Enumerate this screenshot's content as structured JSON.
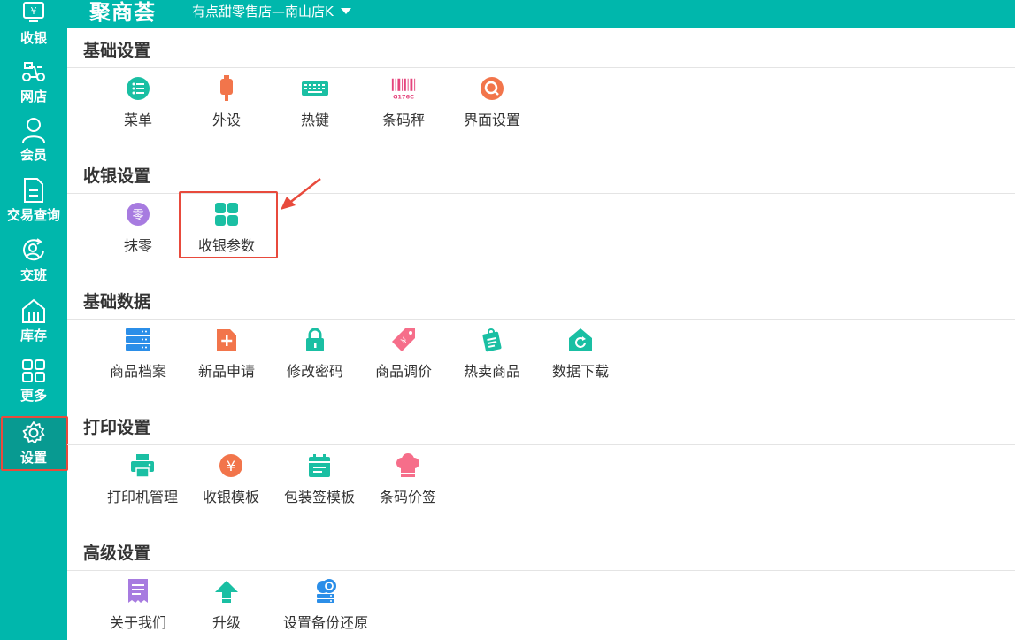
{
  "app": {
    "logo_text": "聚商荟",
    "store_name": "有点甜零售店—南山店K"
  },
  "sidebar": {
    "items": [
      {
        "label": "收银",
        "icon": "cash-register-icon"
      },
      {
        "label": "网店",
        "icon": "delivery-scooter-icon"
      },
      {
        "label": "会员",
        "icon": "member-user-icon"
      },
      {
        "label": "交易查询",
        "icon": "document-icon"
      },
      {
        "label": "交班",
        "icon": "shift-handover-icon"
      },
      {
        "label": "库存",
        "icon": "warehouse-icon"
      },
      {
        "label": "更多",
        "icon": "grid-more-icon"
      },
      {
        "label": "设置",
        "icon": "gear-icon",
        "active": true
      }
    ]
  },
  "sections": [
    {
      "title": "基础设置",
      "items": [
        {
          "label": "菜单",
          "icon": "menu-list-icon",
          "color": "#1abfa3"
        },
        {
          "label": "外设",
          "icon": "peripheral-device-icon",
          "color": "#f2754b"
        },
        {
          "label": "热键",
          "icon": "keyboard-icon",
          "color": "#1abfa3"
        },
        {
          "label": "条码秤",
          "icon": "barcode-scale-icon",
          "color": "#e5457d",
          "icon_text": "G176C"
        },
        {
          "label": "界面设置",
          "icon": "interface-search-icon",
          "color": "#f2754b"
        }
      ]
    },
    {
      "title": "收银设置",
      "items": [
        {
          "label": "抹零",
          "icon": "round-off-icon",
          "color": "#a77be0",
          "icon_text": "零"
        },
        {
          "label": "收银参数",
          "icon": "four-squares-icon",
          "color": "#1abfa3"
        }
      ]
    },
    {
      "title": "基础数据",
      "items": [
        {
          "label": "商品档案",
          "icon": "server-archive-icon",
          "color": "#2b8ee8"
        },
        {
          "label": "新品申请",
          "icon": "new-file-icon",
          "color": "#f2754b"
        },
        {
          "label": "修改密码",
          "icon": "lock-icon",
          "color": "#1abfa3"
        },
        {
          "label": "商品调价",
          "icon": "price-tag-icon",
          "color": "#f66e8a",
          "icon_text": "¥"
        },
        {
          "label": "热卖商品",
          "icon": "hot-goods-icon",
          "color": "#1abfa3"
        },
        {
          "label": "数据下载",
          "icon": "data-download-icon",
          "color": "#1abfa3"
        }
      ]
    },
    {
      "title": "打印设置",
      "items": [
        {
          "label": "打印机管理",
          "icon": "printer-icon",
          "color": "#1abfa3"
        },
        {
          "label": "收银模板",
          "icon": "yen-coin-icon",
          "color": "#f2754b",
          "icon_text": "¥"
        },
        {
          "label": "包装签模板",
          "icon": "calendar-label-icon",
          "color": "#1abfa3"
        },
        {
          "label": "条码价签",
          "icon": "chef-hat-icon",
          "color": "#f66e8a"
        }
      ]
    },
    {
      "title": "高级设置",
      "items": [
        {
          "label": "关于我们",
          "icon": "about-receipt-icon",
          "color": "#a77be0"
        },
        {
          "label": "升级",
          "icon": "upgrade-arrow-icon",
          "color": "#1abfa3"
        },
        {
          "label": "设置备份还原",
          "icon": "cloud-backup-icon",
          "color": "#2b8ee8"
        }
      ]
    }
  ]
}
